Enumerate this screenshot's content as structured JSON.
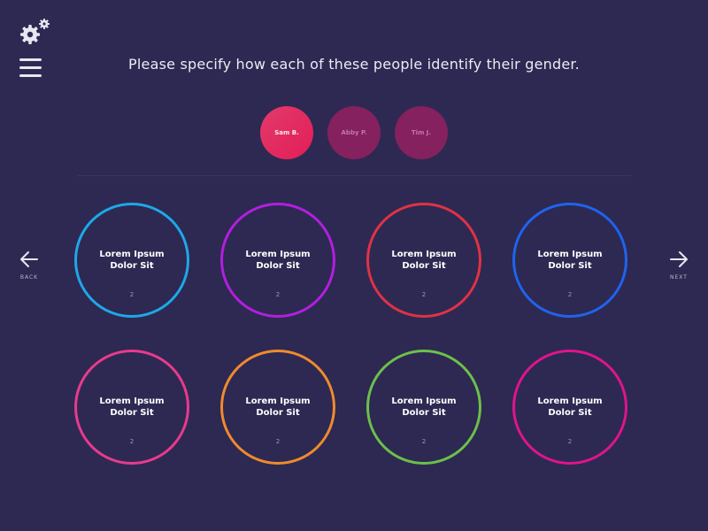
{
  "header": {
    "logo_icon": "gears-icon",
    "menu_icon": "hamburger-menu-icon",
    "question": "Please specify how each of these people identify their gender."
  },
  "people": [
    {
      "name": "Sam B.",
      "selected": true
    },
    {
      "name": "Abby P.",
      "selected": false
    },
    {
      "name": "Tim J.",
      "selected": false
    }
  ],
  "nav": {
    "back_label": "BACK",
    "back_icon": "arrow-left-icon",
    "next_label": "NEXT",
    "next_icon": "arrow-right-icon"
  },
  "options": [
    {
      "line1": "Lorem Ipsum",
      "line2": "Dolor Sit",
      "count": "2",
      "color": "#1ea8e8"
    },
    {
      "line1": "Lorem Ipsum",
      "line2": "Dolor Sit",
      "count": "2",
      "color": "#b31ee0"
    },
    {
      "line1": "Lorem Ipsum",
      "line2": "Dolor Sit",
      "count": "2",
      "color": "#e03245"
    },
    {
      "line1": "Lorem Ipsum",
      "line2": "Dolor Sit",
      "count": "2",
      "color": "#1f63ee"
    },
    {
      "line1": "Lorem Ipsum",
      "line2": "Dolor Sit",
      "count": "2",
      "color": "#ea3a8c"
    },
    {
      "line1": "Lorem Ipsum",
      "line2": "Dolor Sit",
      "count": "2",
      "color": "#f08a2e"
    },
    {
      "line1": "Lorem Ipsum",
      "line2": "Dolor Sit",
      "count": "2",
      "color": "#6cc04a"
    },
    {
      "line1": "Lorem Ipsum",
      "line2": "Dolor Sit",
      "count": "2",
      "color": "#e0148c"
    }
  ],
  "colors": {
    "background": "#2d2952",
    "selected_person": "#e11e57",
    "unselected_person": "#84215e"
  }
}
